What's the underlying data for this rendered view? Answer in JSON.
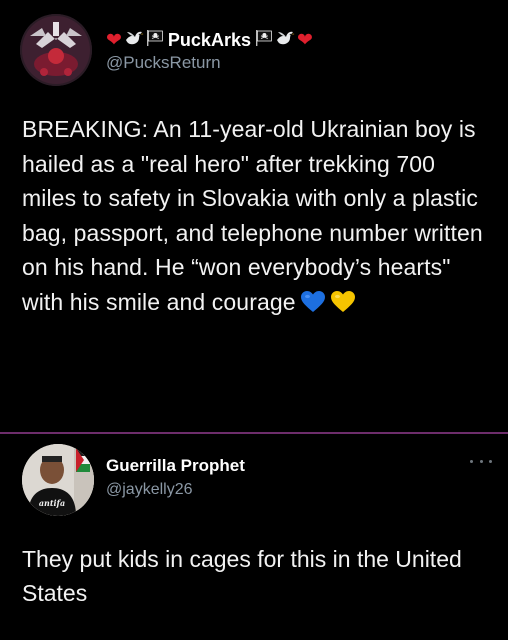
{
  "tweet": {
    "author": {
      "display_name": "PuckArks",
      "handle": "@PucksReturn",
      "name_prefix_icons": [
        "red-heart-icon",
        "dove-icon",
        "pirate-flag-icon"
      ],
      "name_suffix_icons": [
        "pirate-flag-icon",
        "dove-icon",
        "red-heart-icon"
      ]
    },
    "text": "BREAKING: An 11-year-old Ukrainian boy is hailed as a \"real hero\" after trekking 700 miles to safety in Slovakia with only a plastic bag, passport, and telephone number written on his hand. He “won everybody’s hearts\" with his smile and courage",
    "trailing_emojis": [
      "blue-heart-icon",
      "yellow-heart-icon"
    ]
  },
  "reply": {
    "author": {
      "display_name": "Guerrilla Prophet",
      "handle": "@jaykelly26",
      "shirt_text": "antifa"
    },
    "text": "They put kids in cages for this in the United States"
  },
  "colors": {
    "background": "#000000",
    "divider": "#6d2d6b",
    "secondary_text": "#8b98a5",
    "heart_red": "#e0202e",
    "heart_blue": "#1d6fe0",
    "heart_yellow": "#f5c400"
  }
}
